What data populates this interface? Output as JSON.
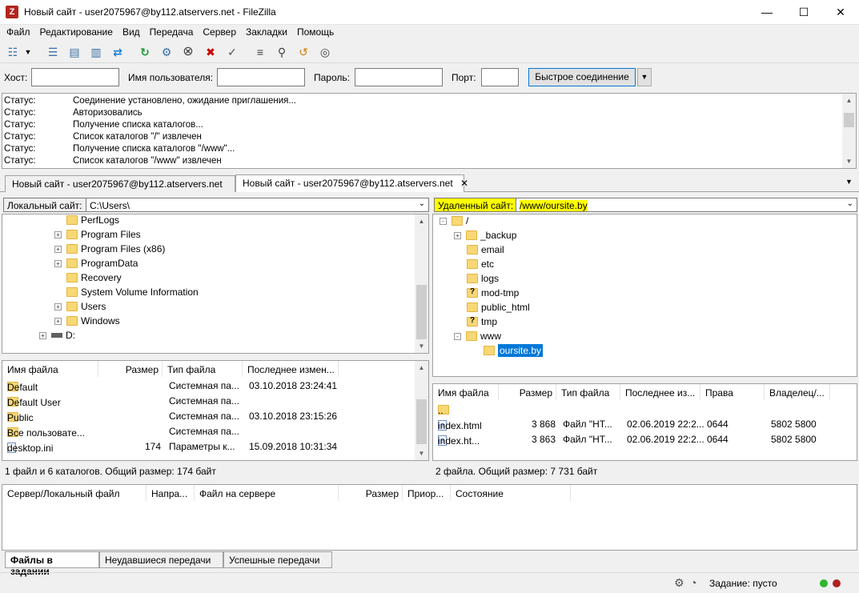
{
  "window": {
    "title": "Новый сайт - user2075967@by112.atservers.net - FileZilla",
    "app_icon_text": "Z"
  },
  "menu": [
    "Файл",
    "Редактирование",
    "Вид",
    "Передача",
    "Сервер",
    "Закладки",
    "Помощь"
  ],
  "quickconnect": {
    "host_label": "Хост:",
    "user_label": "Имя пользователя:",
    "pass_label": "Пароль:",
    "port_label": "Порт:",
    "connect_button": "Быстрое соединение",
    "host": "",
    "user": "",
    "pass": "",
    "port": ""
  },
  "log": [
    {
      "key": "Статус:",
      "text": "Соединение установлено, ожидание приглашения..."
    },
    {
      "key": "Статус:",
      "text": "Авторизовались"
    },
    {
      "key": "Статус:",
      "text": "Получение списка каталогов..."
    },
    {
      "key": "Статус:",
      "text": "Список каталогов \"/\" извлечен"
    },
    {
      "key": "Статус:",
      "text": "Получение списка каталогов \"/www\"..."
    },
    {
      "key": "Статус:",
      "text": "Список каталогов \"/www\" извлечен"
    }
  ],
  "tabs": [
    {
      "label": "Новый сайт - user2075967@by112.atservers.net",
      "active": false
    },
    {
      "label": "Новый сайт - user2075967@by112.atservers.net",
      "active": true
    }
  ],
  "local": {
    "site_label": "Локальный сайт:",
    "path": "C:\\Users\\",
    "tree": [
      {
        "name": "PerfLogs",
        "expander": ""
      },
      {
        "name": "Program Files",
        "expander": "+"
      },
      {
        "name": "Program Files (x86)",
        "expander": "+"
      },
      {
        "name": "ProgramData",
        "expander": "+"
      },
      {
        "name": "Recovery",
        "expander": ""
      },
      {
        "name": "System Volume Information",
        "expander": ""
      },
      {
        "name": "Users",
        "expander": "+"
      },
      {
        "name": "Windows",
        "expander": "+"
      }
    ],
    "drive": "D:",
    "columns": [
      "Имя файла",
      "Размер",
      "Тип файла",
      "Последнее измен..."
    ],
    "files": [
      {
        "name": "Default",
        "size": "",
        "type": "Системная па...",
        "modified": "03.10.2018 23:24:41",
        "icon": "folder"
      },
      {
        "name": "Default User",
        "size": "",
        "type": "Системная па...",
        "modified": "",
        "icon": "folder"
      },
      {
        "name": "Public",
        "size": "",
        "type": "Системная па...",
        "modified": "03.10.2018 23:15:26",
        "icon": "folder"
      },
      {
        "name": "Все пользовате...",
        "size": "",
        "type": "Системная па...",
        "modified": "",
        "icon": "folder"
      },
      {
        "name": "desktop.ini",
        "size": "174",
        "type": "Параметры к...",
        "modified": "15.09.2018 10:31:34",
        "icon": "file"
      }
    ],
    "status": "1 файл и 6 каталогов. Общий размер: 174 байт"
  },
  "remote": {
    "site_label": "Удаленный сайт:",
    "path": "/www/oursite.by",
    "highlight_color": "#ffff00",
    "tree": [
      {
        "name": "/",
        "level": 0,
        "expander": "-",
        "q": false
      },
      {
        "name": "_backup",
        "level": 1,
        "expander": "+",
        "q": false
      },
      {
        "name": "email",
        "level": 1,
        "expander": "",
        "q": false
      },
      {
        "name": "etc",
        "level": 1,
        "expander": "",
        "q": false
      },
      {
        "name": "logs",
        "level": 1,
        "expander": "",
        "q": false
      },
      {
        "name": "mod-tmp",
        "level": 1,
        "expander": "",
        "q": true
      },
      {
        "name": "public_html",
        "level": 1,
        "expander": "",
        "q": false
      },
      {
        "name": "tmp",
        "level": 1,
        "expander": "",
        "q": true
      },
      {
        "name": "www",
        "level": 1,
        "expander": "-",
        "q": false
      },
      {
        "name": "oursite.by",
        "level": 2,
        "expander": "",
        "q": false,
        "selected": true
      }
    ],
    "columns": [
      "Имя файла",
      "Размер",
      "Тип файла",
      "Последнее из...",
      "Права",
      "Владелец/..."
    ],
    "files": [
      {
        "name": "..",
        "size": "",
        "type": "",
        "modified": "",
        "perm": "",
        "owner": "",
        "icon": "folder"
      },
      {
        "name": "index.html",
        "size": "3 868",
        "type": "Файл \"НТ...",
        "modified": "02.06.2019 22:2...",
        "perm": "0644",
        "owner": "5802 5800",
        "icon": "html"
      },
      {
        "name": "index.ht...",
        "size": "3 863",
        "type": "Файл \"НТ...",
        "modified": "02.06.2019 22:2...",
        "perm": "0644",
        "owner": "5802 5800",
        "icon": "html"
      }
    ],
    "status": "2 файла. Общий размер: 7 731 байт"
  },
  "queue": {
    "columns": [
      "Сервер/Локальный файл",
      "Напра...",
      "Файл на сервере",
      "Размер",
      "Приор...",
      "Состояние"
    ],
    "tabs": [
      "Файлы в задании",
      "Неудавшиеся передачи",
      "Успешные передачи"
    ]
  },
  "statusbar": {
    "queue_text": "Задание: пусто"
  }
}
